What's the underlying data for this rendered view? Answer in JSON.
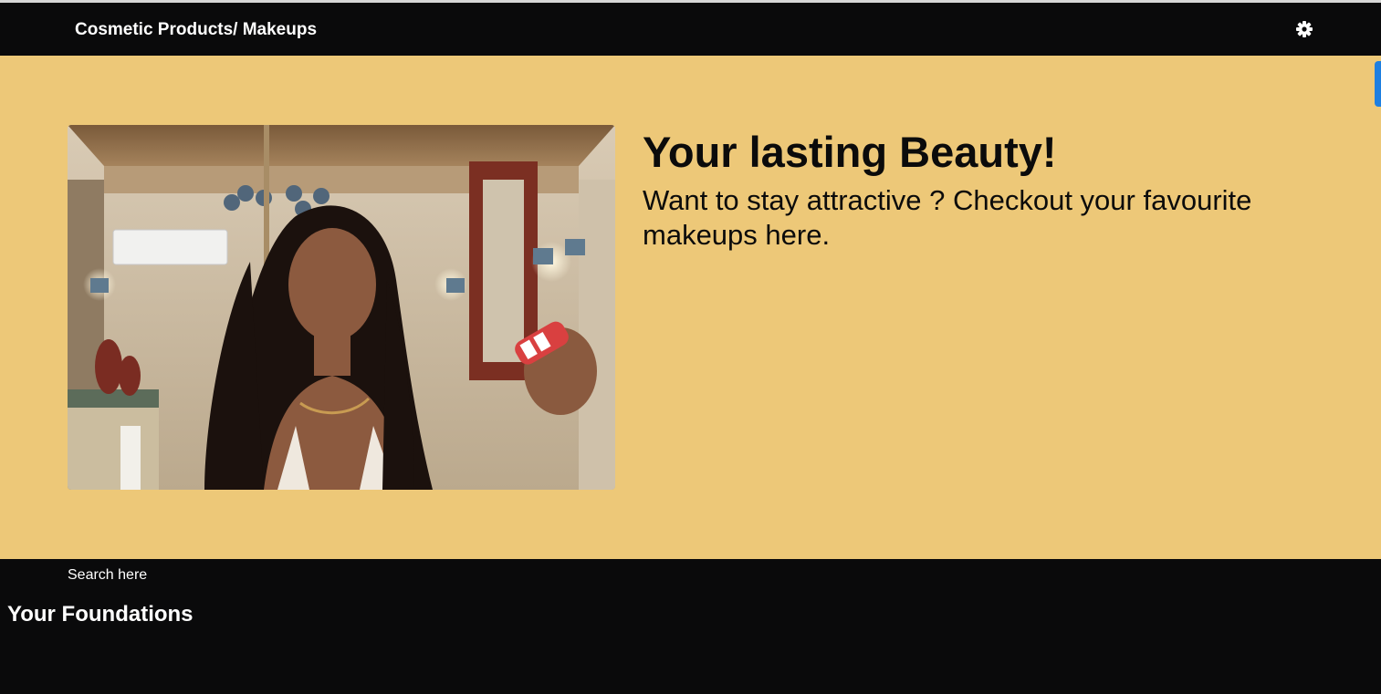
{
  "navbar": {
    "brand": "Cosmetic Products/ Makeups",
    "settings_icon": "gear-icon"
  },
  "hero": {
    "title": "Your lasting Beauty!",
    "subtitle": "Want to stay attractive ? Checkout your favourite makeups here.",
    "image_icon": "woman-with-lipstick-photo"
  },
  "search": {
    "label": "Search here"
  },
  "sections": {
    "foundations_title": "Your Foundations"
  },
  "colors": {
    "navbar_bg": "#0a0a0b",
    "hero_bg": "#edc878",
    "accent_scroll": "#1e7fe0",
    "text_light": "#ffffff",
    "text_dark": "#0b0b0b"
  }
}
